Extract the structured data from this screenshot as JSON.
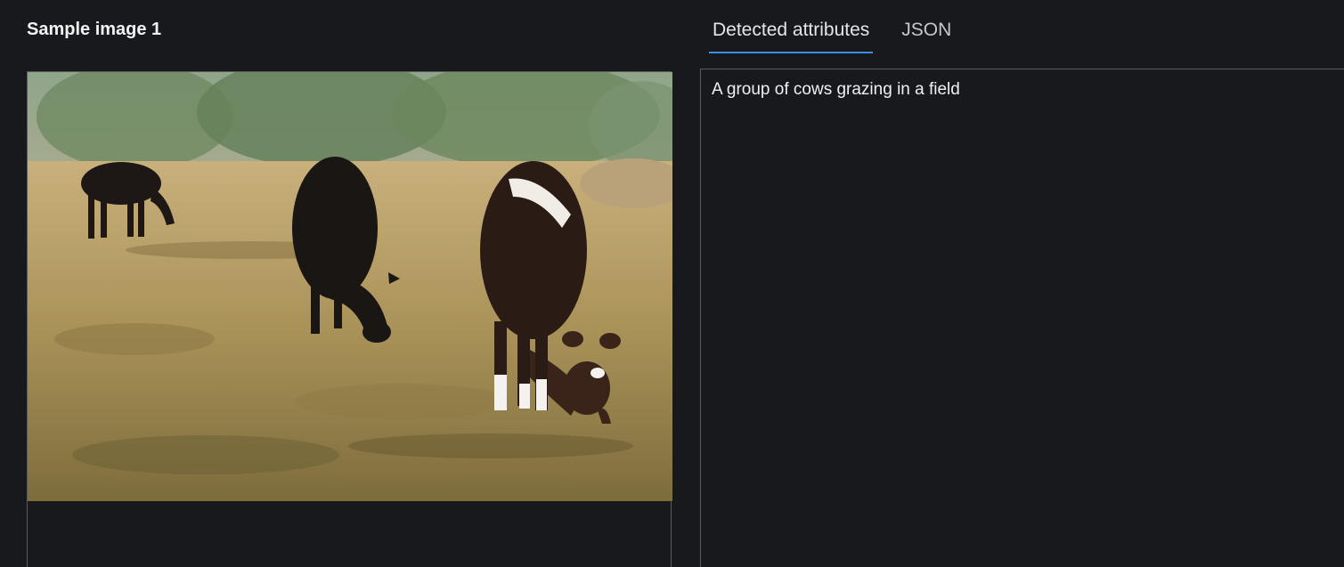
{
  "left_panel": {
    "title": "Sample image 1",
    "image_alt": "Photo of three cows grazing in a dry grassy field"
  },
  "tabs": [
    {
      "label": "Detected attributes",
      "active": true
    },
    {
      "label": "JSON",
      "active": false
    }
  ],
  "result": {
    "caption": "A group of cows grazing in a field"
  },
  "colors": {
    "background": "#18191c",
    "border": "#5a5a5a",
    "accent": "#3a8ee6",
    "text": "#f0f0f0"
  }
}
